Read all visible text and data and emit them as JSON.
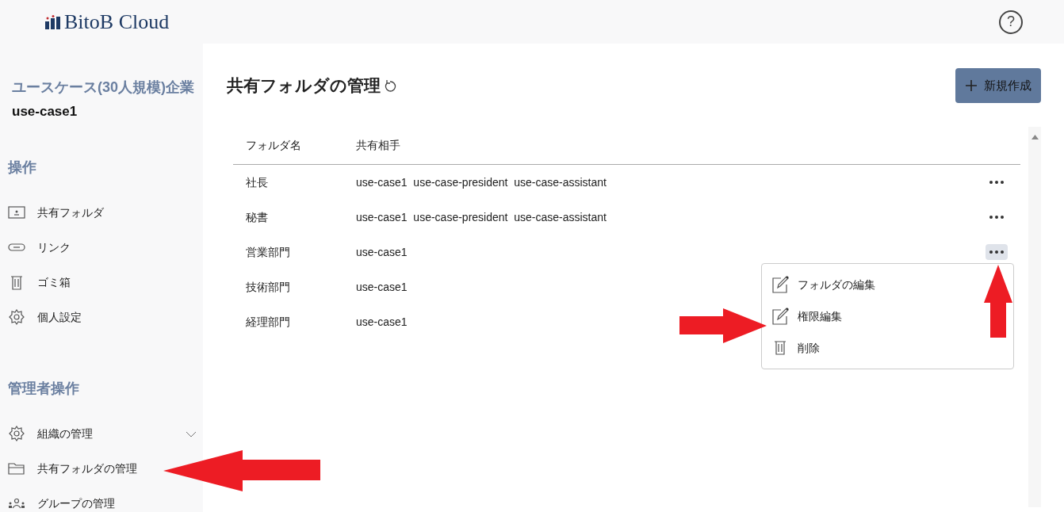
{
  "header": {
    "logo": "BitoB Cloud",
    "help": "?"
  },
  "sidebar": {
    "company": "ユースケース(30人規模)企業",
    "user": "use-case1",
    "sections": [
      {
        "title": "操作",
        "items": [
          {
            "label": "共有フォルダ",
            "expandable": false
          },
          {
            "label": "リンク",
            "expandable": false
          },
          {
            "label": "ゴミ箱",
            "expandable": false
          },
          {
            "label": "個人設定",
            "expandable": false
          }
        ]
      },
      {
        "title": "管理者操作",
        "items": [
          {
            "label": "組織の管理",
            "expandable": true
          },
          {
            "label": "共有フォルダの管理",
            "expandable": false
          },
          {
            "label": "グループの管理",
            "expandable": false
          }
        ]
      }
    ]
  },
  "page": {
    "title": "共有フォルダの管理",
    "new_button": "新規作成"
  },
  "table": {
    "columns": [
      "フォルダ名",
      "共有相手"
    ],
    "rows": [
      {
        "name": "社長",
        "shared": [
          "use-case1",
          "use-case-president",
          "use-case-assistant"
        ],
        "menu_open": false
      },
      {
        "name": "秘書",
        "shared": [
          "use-case1",
          "use-case-president",
          "use-case-assistant"
        ],
        "menu_open": false
      },
      {
        "name": "営業部門",
        "shared": [
          "use-case1"
        ],
        "menu_open": true
      },
      {
        "name": "技術部門",
        "shared": [
          "use-case1"
        ],
        "menu_open": false
      },
      {
        "name": "経理部門",
        "shared": [
          "use-case1"
        ],
        "menu_open": false
      }
    ]
  },
  "context_menu": [
    {
      "label": "フォルダの編集"
    },
    {
      "label": "権限編集"
    },
    {
      "label": "削除"
    }
  ]
}
